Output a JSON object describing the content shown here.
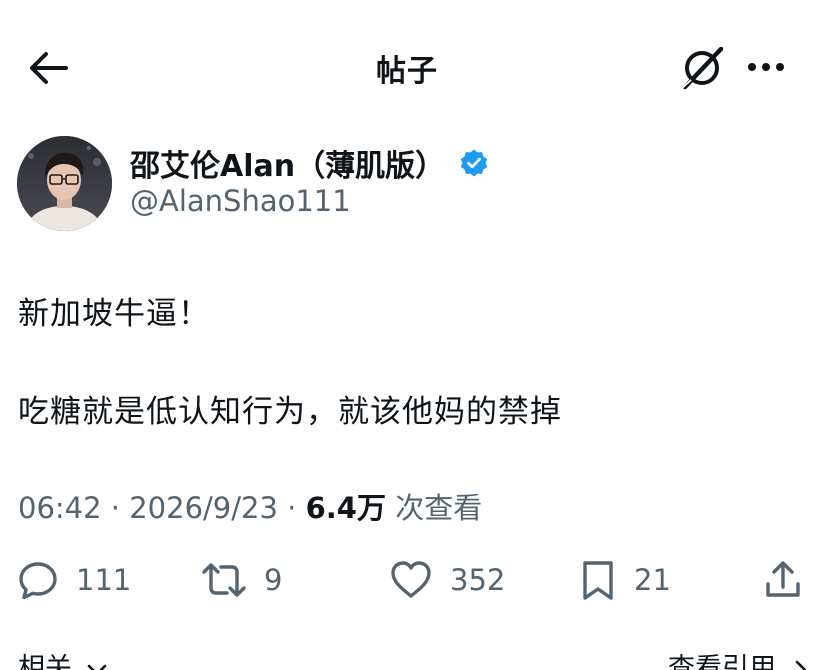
{
  "header": {
    "title": "帖子",
    "back_icon": "arrow-left-icon",
    "grok_icon": "grok-icon",
    "more_icon": "more-dots-icon"
  },
  "author": {
    "name": "邵艾伦Alan（薄肌版）",
    "handle": "@AlanShao111",
    "verified": true,
    "verified_color": "#1d9bf0"
  },
  "post": {
    "line1": "新加坡牛逼！",
    "line2": "吃糖就是低认知行为，就该他妈的禁掉"
  },
  "meta": {
    "time": "06:42",
    "separator": " · ",
    "date": "2026/9/23",
    "views": "6.4万",
    "views_label": "次查看"
  },
  "actions": {
    "reply_count": "111",
    "repost_count": "9",
    "like_count": "352",
    "bookmark_count": "21"
  },
  "footer": {
    "related_label": "相关",
    "quotes_label": "查看引用"
  },
  "colors": {
    "text_primary": "#0f1419",
    "text_secondary": "#536471",
    "accent": "#1d9bf0"
  }
}
